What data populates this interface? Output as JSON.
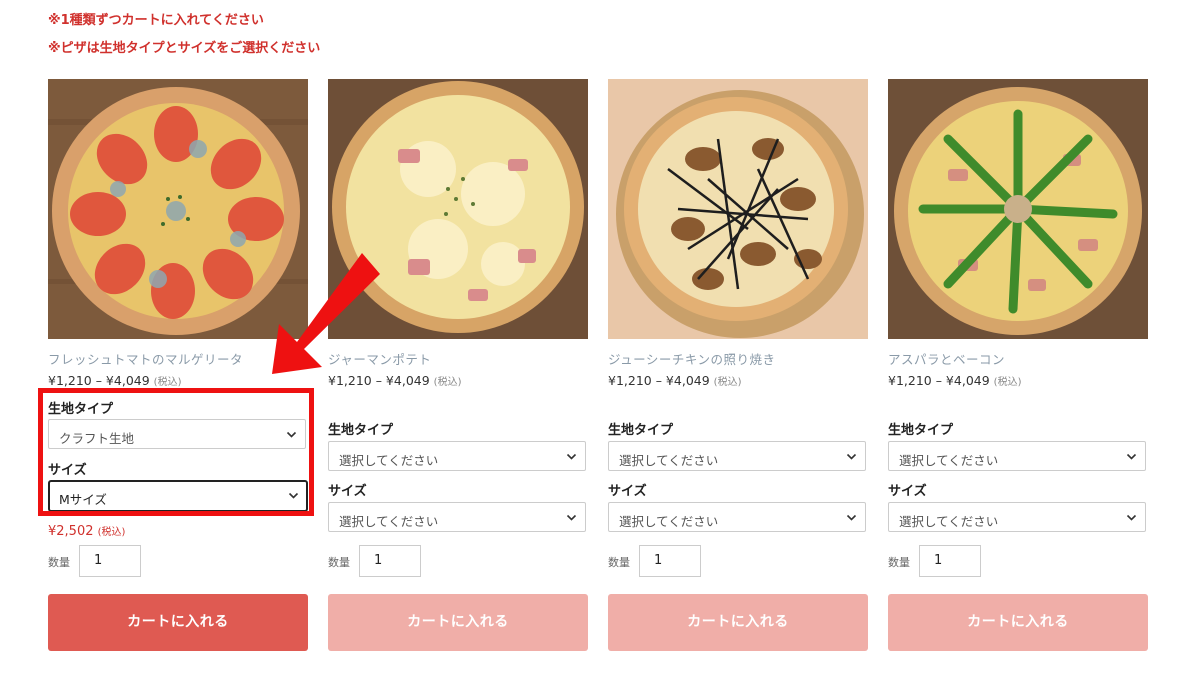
{
  "notices": [
    "※1種類ずつカートに入れてください",
    "※ピザは生地タイプとサイズをご選択ください"
  ],
  "labels": {
    "dough": "生地タイプ",
    "size": "サイズ",
    "qty": "数量",
    "tax": "(税込)",
    "cart_button": "カートに入れる"
  },
  "products": [
    {
      "name": "フレッシュトマトのマルゲリータ",
      "price_range": "¥1,210 – ¥4,049",
      "dough_value": "クラフト生地",
      "size_value": "Mサイズ",
      "calc_price": "¥2,502",
      "qty": "1",
      "button_enabled": true
    },
    {
      "name": "ジャーマンポテト",
      "price_range": "¥1,210 – ¥4,049",
      "dough_value": "選択してください",
      "size_value": "選択してください",
      "qty": "1",
      "button_enabled": false
    },
    {
      "name": "ジューシーチキンの照り焼き",
      "price_range": "¥1,210 – ¥4,049",
      "dough_value": "選択してください",
      "size_value": "選択してください",
      "qty": "1",
      "button_enabled": false
    },
    {
      "name": "アスパラとベーコン",
      "price_range": "¥1,210 – ¥4,049",
      "dough_value": "選択してください",
      "size_value": "選択してください",
      "qty": "1",
      "button_enabled": false
    }
  ],
  "colors": {
    "accent": "#d0312d",
    "button": "#df5a52",
    "button_disabled": "#f0aea8",
    "highlight": "#ee1111"
  }
}
